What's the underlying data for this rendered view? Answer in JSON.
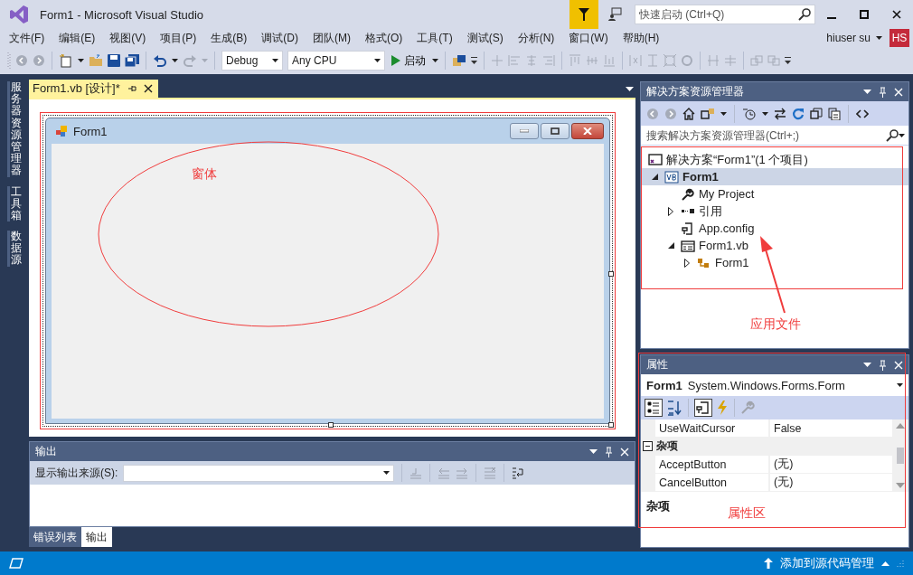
{
  "window": {
    "title": "Form1 - Microsoft Visual Studio",
    "quick_launch": {
      "placeholder": "快速启动 (Ctrl+Q)"
    }
  },
  "menu": [
    "文件(F)",
    "编辑(E)",
    "视图(V)",
    "项目(P)",
    "生成(B)",
    "调试(D)",
    "团队(M)",
    "格式(O)",
    "工具(T)",
    "测试(S)",
    "分析(N)",
    "窗口(W)",
    "帮助(H)"
  ],
  "account": {
    "user": "hiuser su",
    "initials": "HS"
  },
  "toolbar": {
    "configuration": "Debug",
    "platform": "Any CPU",
    "start": "启动"
  },
  "side_tabs": [
    "服务器资源管理器",
    "工具箱",
    "数据源"
  ],
  "editor": {
    "tabs": [
      {
        "label": "Form1.vb [设计]*",
        "selected": true
      }
    ],
    "form": {
      "title": "Form1"
    },
    "annotation": "窗体"
  },
  "output": {
    "title": "输出",
    "source_label": "显示输出来源(S):",
    "tabs": [
      {
        "label": "错误列表",
        "selected": false
      },
      {
        "label": "输出",
        "selected": true
      }
    ]
  },
  "solution_explorer": {
    "title": "解决方案资源管理器",
    "search": {
      "placeholder": "搜索解决方案资源管理器(Ctrl+;)"
    },
    "solution": "解决方案“Form1”(1 个项目)",
    "tree": [
      {
        "label": "Form1",
        "kind": "project",
        "expanded": true,
        "selected": true,
        "children": [
          {
            "label": "My Project",
            "kind": "settings",
            "selected": false
          },
          {
            "label": "引用",
            "kind": "references",
            "expanded": false,
            "selected": false
          },
          {
            "label": "App.config",
            "kind": "config",
            "selected": false
          },
          {
            "label": "Form1.vb",
            "kind": "form",
            "expanded": true,
            "selected": false,
            "children": [
              {
                "label": "Form1",
                "kind": "class",
                "expanded": false,
                "selected": false
              }
            ]
          }
        ]
      }
    ],
    "annotation": "应用文件"
  },
  "properties": {
    "title": "属性",
    "object": "Form1",
    "type": "System.Windows.Forms.Form",
    "rows": [
      {
        "kind": "property",
        "name": "UseWaitCursor",
        "value": "False"
      },
      {
        "kind": "category",
        "name": "杂项",
        "expanded": true
      },
      {
        "kind": "property",
        "name": "AcceptButton",
        "value": "(无)"
      },
      {
        "kind": "property",
        "name": "CancelButton",
        "value": "(无)"
      }
    ],
    "description": "杂项",
    "annotation": "属性区"
  },
  "status_bar": {
    "source_control": "添加到源代码管理"
  }
}
